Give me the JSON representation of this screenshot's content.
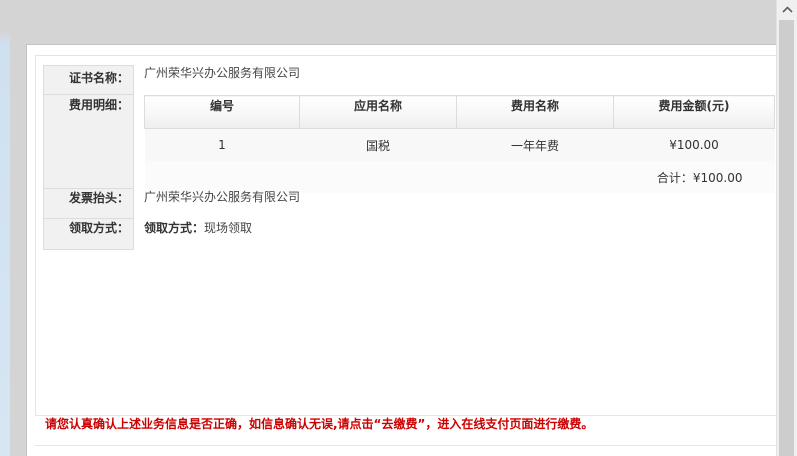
{
  "form": {
    "cert_name_label": "证书名称：",
    "cert_name_value": "广州荣华兴办公服务有限公司",
    "fee_detail_label": "费用明细：",
    "invoice_title_label": "发票抬头：",
    "invoice_title_value": "广州荣华兴办公服务有限公司",
    "pickup_label": "领取方式：",
    "pickup_value_prefix": "领取方式：",
    "pickup_value": "现场领取"
  },
  "fee_table": {
    "headers": [
      "编号",
      "应用名称",
      "费用名称",
      "费用金额(元)"
    ],
    "rows": [
      {
        "no": "1",
        "app": "国税",
        "fee_name": "一年年费",
        "amount": "¥100.00"
      }
    ],
    "total": "合计：¥100.00"
  },
  "notice": "请您认真确认上述业务信息是否正确，如信息确认无误,请点击“去缴费”，进入在线支付页面进行缴费。",
  "icons": {
    "scroll_up": "chevron-up-icon"
  }
}
